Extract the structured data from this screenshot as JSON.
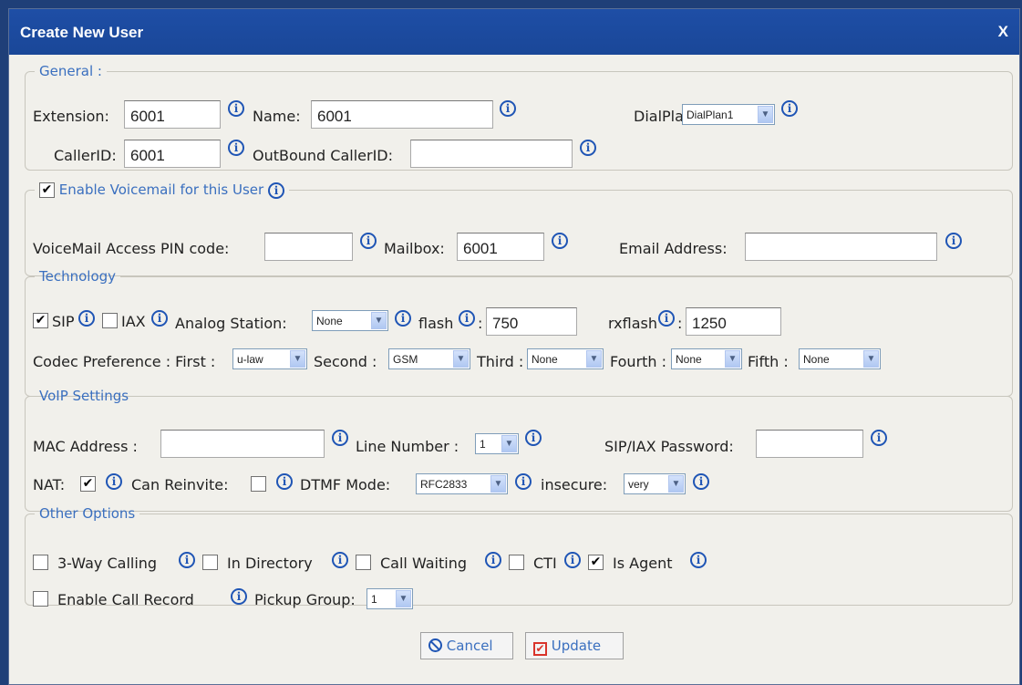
{
  "dialog": {
    "title": "Create New User",
    "close_label": "X"
  },
  "general": {
    "legend": "General :",
    "extension_label": "Extension:",
    "extension_value": "6001",
    "name_label": "Name:",
    "name_value": "6001",
    "dialplan_label": "DialPlan:",
    "dialplan_value": "DialPlan1",
    "callerid_label": "CallerID:",
    "callerid_value": "6001",
    "outbound_label": "OutBound CallerID:",
    "outbound_value": ""
  },
  "voicemail": {
    "legend": "Enable Voicemail for this User",
    "enabled": true,
    "pin_label": "VoiceMail Access PIN code:",
    "pin_value": "",
    "mailbox_label": "Mailbox:",
    "mailbox_value": "6001",
    "email_label": "Email Address:",
    "email_value": ""
  },
  "technology": {
    "legend": "Technology",
    "sip_label": "SIP",
    "sip_checked": true,
    "iax_label": "IAX",
    "iax_checked": false,
    "analog_label": "Analog Station:",
    "analog_value": "None",
    "flash_label": "flash",
    "flash_value": "750",
    "rxflash_label": "rxflash",
    "rxflash_value": "1250",
    "codec_label": "Codec Preference : First :",
    "first_value": "u-law",
    "second_label": "Second :",
    "second_value": "GSM",
    "third_label": "Third :",
    "third_value": "None",
    "fourth_label": "Fourth :",
    "fourth_value": "None",
    "fifth_label": "Fifth :",
    "fifth_value": "None"
  },
  "voip": {
    "legend": "VoIP Settings",
    "mac_label": "MAC Address :",
    "mac_value": "",
    "line_label": "Line Number :",
    "line_value": "1",
    "password_label": "SIP/IAX Password:",
    "password_value": "",
    "nat_label": "NAT:",
    "nat_checked": true,
    "reinvite_label": "Can Reinvite:",
    "reinvite_checked": false,
    "dtmf_label": "DTMF Mode:",
    "dtmf_value": "RFC2833",
    "insecure_label": "insecure:",
    "insecure_value": "very"
  },
  "other": {
    "legend": "Other Options",
    "threeway_label": "3-Way Calling",
    "threeway_checked": false,
    "directory_label": "In Directory",
    "directory_checked": false,
    "waiting_label": "Call Waiting",
    "waiting_checked": false,
    "cti_label": "CTI",
    "cti_checked": false,
    "agent_label": "Is Agent",
    "agent_checked": true,
    "record_label": "Enable Call Record",
    "record_checked": false,
    "pickup_label": "Pickup Group:",
    "pickup_value": "1"
  },
  "actions": {
    "cancel_label": "Cancel",
    "update_label": "Update"
  },
  "icons": {
    "info": "info-icon",
    "cancel": "no-entry-icon",
    "update": "checkbox-icon"
  },
  "colors": {
    "title_bar": "#1a4798",
    "legend": "#3a6fbf",
    "info_icon": "#1f55b5"
  }
}
